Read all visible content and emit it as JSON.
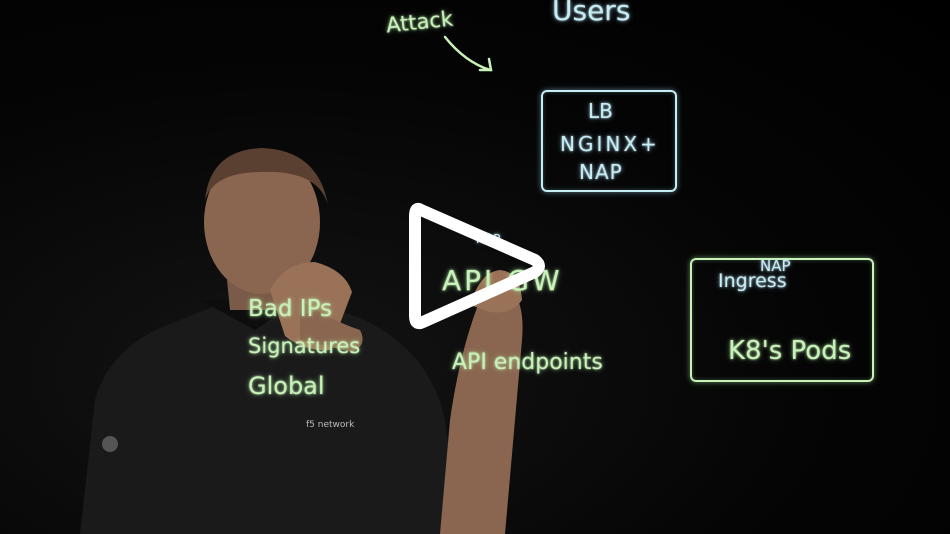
{
  "video": {
    "play_icon": "play-icon",
    "shirt_logo": "f5 network",
    "colors": {
      "ink_green": "#c9f2b8",
      "ink_blue": "#c6ecf4",
      "background": "#000000"
    }
  },
  "board": {
    "users": "Users",
    "attack": "Attack",
    "lb_box": {
      "line1": "LB",
      "line2": "NGINX+",
      "line3": "NAP"
    },
    "api_gw": {
      "nap": "NAP",
      "label": "API GW"
    },
    "ingress_box": {
      "nap": "NAP",
      "ingress": "Ingress",
      "pods": "K8's Pods"
    },
    "features": [
      "Bad IPs",
      "Signatures",
      "Global"
    ],
    "endpoints": "API endpoints"
  }
}
